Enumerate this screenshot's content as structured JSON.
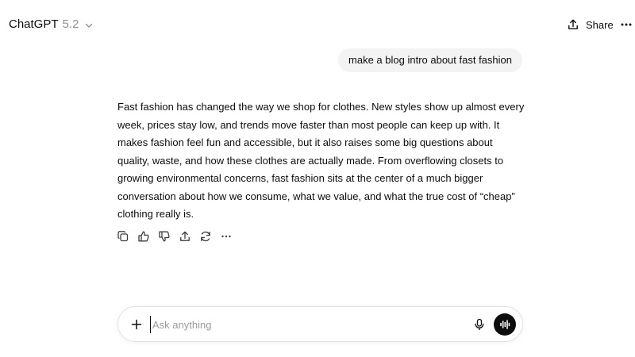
{
  "header": {
    "model_name": "ChatGPT",
    "model_version": "5.2",
    "model_dropdown_icon": "chevron-down-icon",
    "share_label": "Share",
    "share_icon": "share-icon",
    "more_icon": "more-horizontal-icon"
  },
  "conversation": {
    "user_message": "make a blog intro about fast fashion",
    "assistant_message": "Fast fashion has changed the way we shop for clothes. New styles show up almost every week, prices stay low, and trends move faster than most people can keep up with. It makes fashion feel fun and accessible, but it also raises some big questions about quality, waste, and how these clothes are actually made. From overflowing closets to growing environmental concerns, fast fashion sits at the center of a much bigger conversation about how we consume, what we value, and what the true cost of “cheap” clothing really is.",
    "message_actions": [
      "copy-icon",
      "thumbs-up-icon",
      "thumbs-down-icon",
      "share-icon",
      "regenerate-icon",
      "more-horizontal-icon"
    ]
  },
  "composer": {
    "placeholder": "Ask anything",
    "value": "",
    "attach_icon": "plus-icon",
    "dictate_icon": "microphone-icon",
    "voice_icon": "voice-mode-icon"
  }
}
